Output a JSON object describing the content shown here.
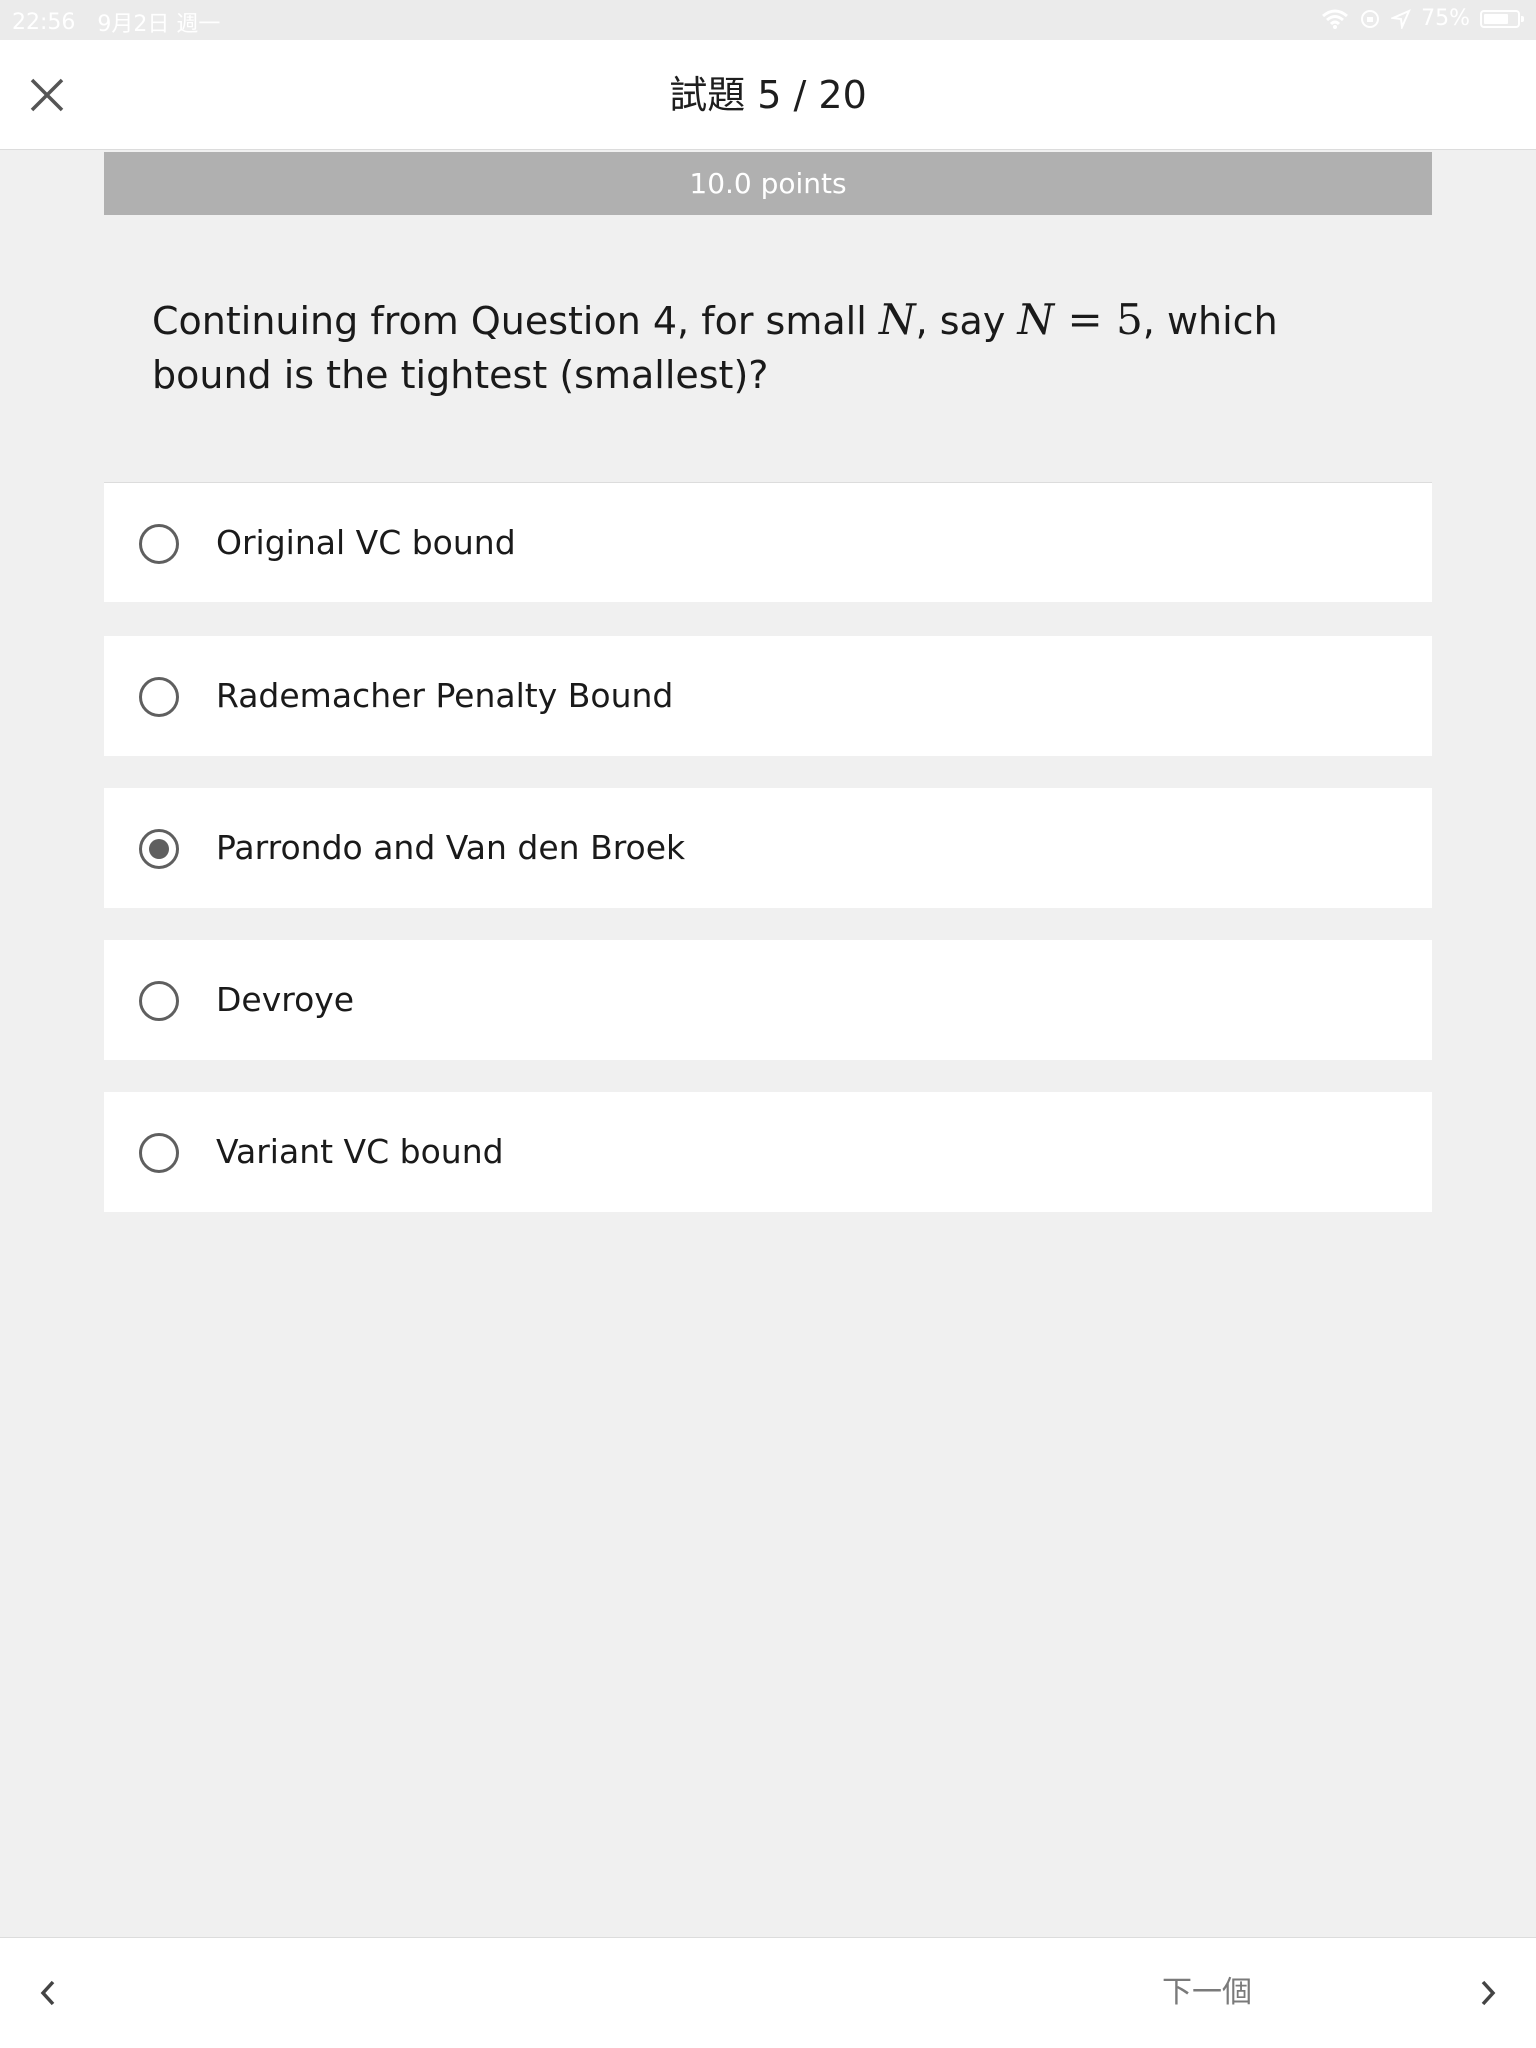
{
  "status_bar": {
    "time": "22:56",
    "date": "9月2日 週一",
    "battery": "75%",
    "battery_level": 0.75,
    "icons": [
      "wifi-icon",
      "orientation-lock-icon",
      "location-icon",
      "battery-icon"
    ]
  },
  "header": {
    "title": "試題 5 / 20",
    "close_icon": "close-icon"
  },
  "question": {
    "points": "10.0 points",
    "text_before": "Continuing from Question 4, for small ",
    "var_n": "N",
    "text_middle": ", say ",
    "equation_lhs": "N",
    "equation_op": " = ",
    "equation_rhs": "5",
    "text_after": ", which bound is the tightest (smallest)?",
    "options": [
      {
        "label": "Original VC bound",
        "selected": false
      },
      {
        "label": "Rademacher Penalty Bound",
        "selected": false
      },
      {
        "label": "Parrondo and Van den Broek",
        "selected": true
      },
      {
        "label": "Devroye",
        "selected": false
      },
      {
        "label": "Variant VC bound",
        "selected": false
      }
    ]
  },
  "footer": {
    "next_label": "下一個",
    "prev_icon": "chevron-left-icon",
    "next_icon": "chevron-right-icon"
  },
  "colors": {
    "page_bg": "#f0f0f0",
    "banner_bg": "#b0b0b0",
    "radio": "#5f5f5f"
  }
}
